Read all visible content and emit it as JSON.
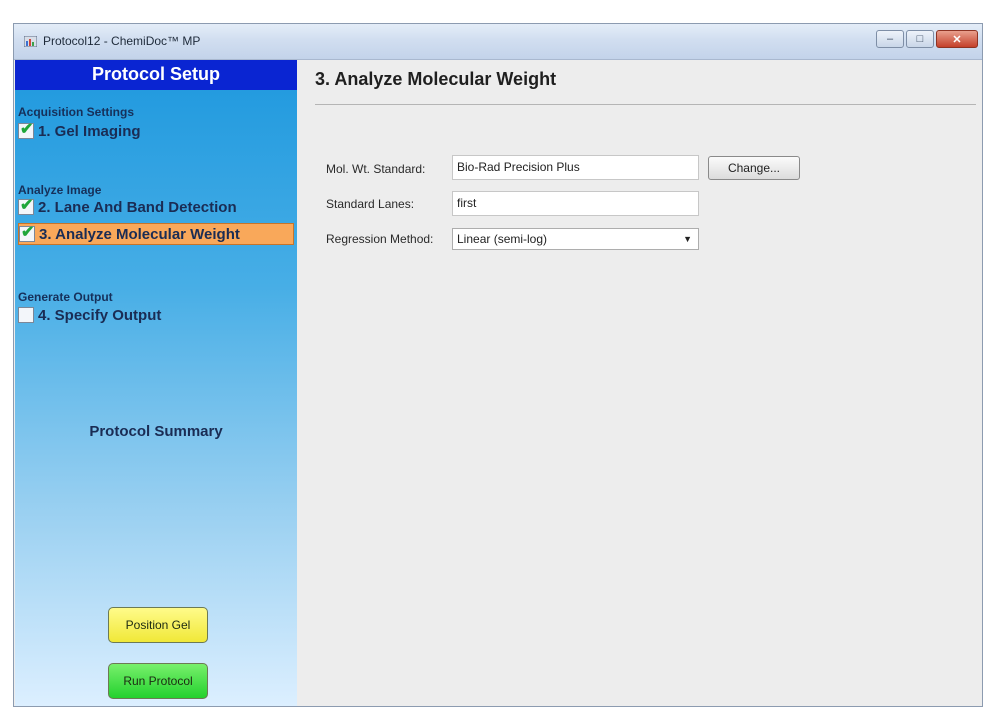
{
  "window": {
    "title": "Protocol12 - ChemiDoc™ MP",
    "app_icon": "chemidoc-app-icon",
    "controls": {
      "minimize": "–",
      "maximize": "□",
      "close": "✕"
    }
  },
  "sidebar": {
    "header": "Protocol Setup",
    "sections": {
      "acquisition": "Acquisition Settings",
      "analyze": "Analyze Image",
      "generate": "Generate Output"
    },
    "steps": [
      {
        "label": "1. Gel Imaging",
        "checked": true
      },
      {
        "label": "2. Lane And Band Detection",
        "checked": true
      },
      {
        "label": "3. Analyze Molecular Weight",
        "checked": true,
        "active": true
      },
      {
        "label": "4. Specify Output",
        "checked": false
      }
    ],
    "check_glyph": "✔",
    "summary": "Protocol Summary",
    "position_gel_button": "Position Gel",
    "run_protocol_button": "Run Protocol",
    "colors": {
      "header": "#0a25d2",
      "active_step": "#f9a85a",
      "position_gel": "#f0e838",
      "run_protocol": "#23d12e"
    }
  },
  "main": {
    "title": "3. Analyze Molecular Weight",
    "mol_wt_label": "Mol. Wt. Standard:",
    "mol_wt_value": "Bio-Rad Precision Plus",
    "change_button": "Change...",
    "standard_lanes_label": "Standard Lanes:",
    "standard_lanes_value": "first",
    "regression_label": "Regression Method:",
    "regression_value": "Linear (semi-log)",
    "dropdown_arrow": "▼"
  }
}
